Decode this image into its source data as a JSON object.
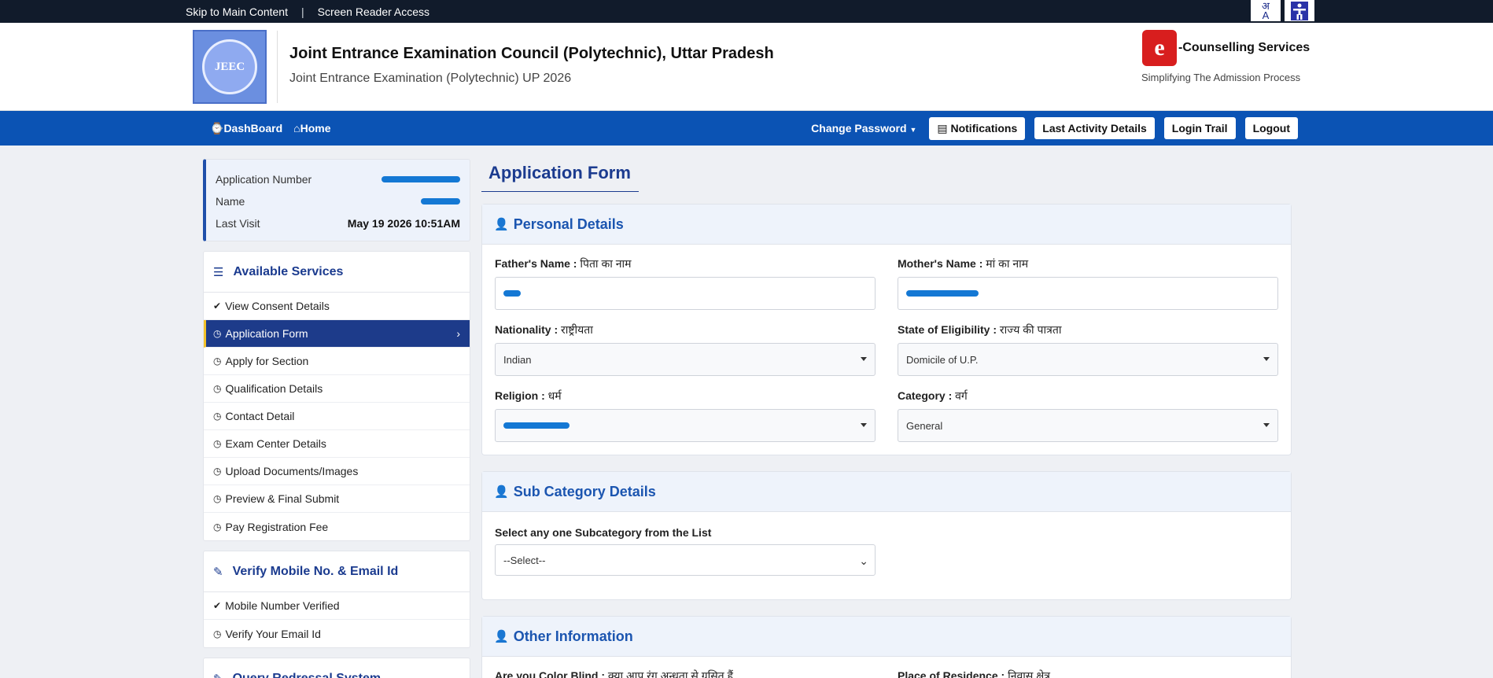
{
  "topbar": {
    "skip_link": "Skip to Main Content",
    "separator": "|",
    "screen_reader": "Screen Reader Access",
    "lang_icon_top": "अ",
    "lang_icon_bottom": "A"
  },
  "header": {
    "logo_text": "JEEC",
    "title": "Joint Entrance Examination Council (Polytechnic), Uttar Pradesh",
    "subtitle": "Joint Entrance Examination (Polytechnic) UP 2026",
    "ecounsel_letter": "e",
    "ecounsel_text": "-Counselling Services",
    "ecounsel_tagline": "Simplifying The Admission Process"
  },
  "nav": {
    "dashboard": "DashBoard",
    "home": "Home",
    "change_password": "Change Password",
    "notifications": "Notifications",
    "last_activity": "Last Activity Details",
    "login_trail": "Login Trail",
    "logout": "Logout"
  },
  "profile": {
    "application_number_label": "Application Number",
    "name_label": "Name",
    "last_visit_label": "Last Visit",
    "last_visit_value": "May 19 2026 10:51AM"
  },
  "services": {
    "title": "Available Services",
    "items": [
      {
        "label": "View Consent Details",
        "icon": "check-circle-icon"
      },
      {
        "label": "Application Form",
        "icon": "clock-icon",
        "active": true
      },
      {
        "label": "Apply for Section",
        "icon": "clock-icon"
      },
      {
        "label": "Qualification Details",
        "icon": "clock-icon"
      },
      {
        "label": "Contact Detail",
        "icon": "clock-icon"
      },
      {
        "label": "Exam Center Details",
        "icon": "clock-icon"
      },
      {
        "label": "Upload Documents/Images",
        "icon": "clock-icon"
      },
      {
        "label": "Preview & Final Submit",
        "icon": "clock-icon"
      },
      {
        "label": "Pay Registration Fee",
        "icon": "clock-icon"
      }
    ]
  },
  "verify": {
    "title": "Verify Mobile No. & Email Id",
    "items": [
      {
        "label": "Mobile Number Verified",
        "icon": "check-circle-icon"
      },
      {
        "label": "Verify Your Email Id",
        "icon": "clock-icon"
      }
    ],
    "next_card_title": "Query Redressal System"
  },
  "form": {
    "page_title": "Application Form",
    "personal": {
      "title": "Personal Details",
      "father_label": "Father's Name : ",
      "father_label_hi": "पिता का नाम",
      "mother_label": "Mother's Name : ",
      "mother_label_hi": "मां का नाम",
      "nationality_label": "Nationality : ",
      "nationality_label_hi": "राष्ट्रीयता",
      "nationality_value": "Indian",
      "state_label": "State of Eligibility : ",
      "state_label_hi": "राज्य की पात्रता",
      "state_value": "Domicile of U.P.",
      "religion_label": "Religion : ",
      "religion_label_hi": "धर्म",
      "category_label": "Category : ",
      "category_label_hi": "वर्ग",
      "category_value": "General"
    },
    "subcategory": {
      "title": "Sub Category Details",
      "select_label": "Select any one Subcategory from the List",
      "select_value": "--Select--"
    },
    "other": {
      "title": "Other Information",
      "color_blind_label": "Are you Color Blind : ",
      "color_blind_label_hi": "क्या आप रंग अन्धता से ग्रसित हैं",
      "residence_label": "Place of Residence : ",
      "residence_label_hi": "निवास क्षेत्र"
    }
  },
  "colors": {
    "nav_blue": "#0b53b4",
    "topbar": "#111b2b",
    "heading_blue": "#1b3b8f",
    "active_item": "#1d3b8a",
    "accent_yellow": "#f2c22a",
    "redaction": "#1478d4"
  }
}
